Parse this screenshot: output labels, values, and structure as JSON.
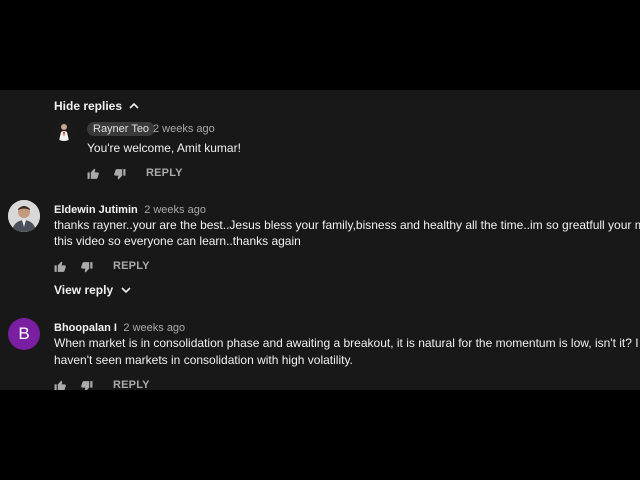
{
  "thread": {
    "hide_replies_label": "Hide replies",
    "reply": {
      "author": "Rayner Teo",
      "time": "2 weeks ago",
      "text": "You're welcome, Amit kumar!",
      "reply_label": "REPLY"
    }
  },
  "comments": [
    {
      "author": "Eldewin Jutimin",
      "time": "2 weeks ago",
      "lines": [
        "thanks rayner..your are the best..Jesus bless your family,bisness and healthy all the time..im so greatfull your make",
        "this video so everyone can learn..thanks again"
      ],
      "reply_label": "REPLY",
      "view_reply_label": "View reply"
    },
    {
      "author": "Bhoopalan I",
      "time": "2 weeks ago",
      "avatar_letter": "B",
      "avatar_color": "#7b1fa2",
      "lines": [
        "When market is in consolidation phase and awaiting a breakout, it is natural for the momentum is low, isn't it? I",
        "haven't seen markets in consolidation with high volatility."
      ],
      "reply_label": "REPLY"
    }
  ],
  "icons": [
    "chevron-up-icon",
    "chevron-down-icon",
    "thumbs-up-icon",
    "thumbs-down-icon"
  ]
}
